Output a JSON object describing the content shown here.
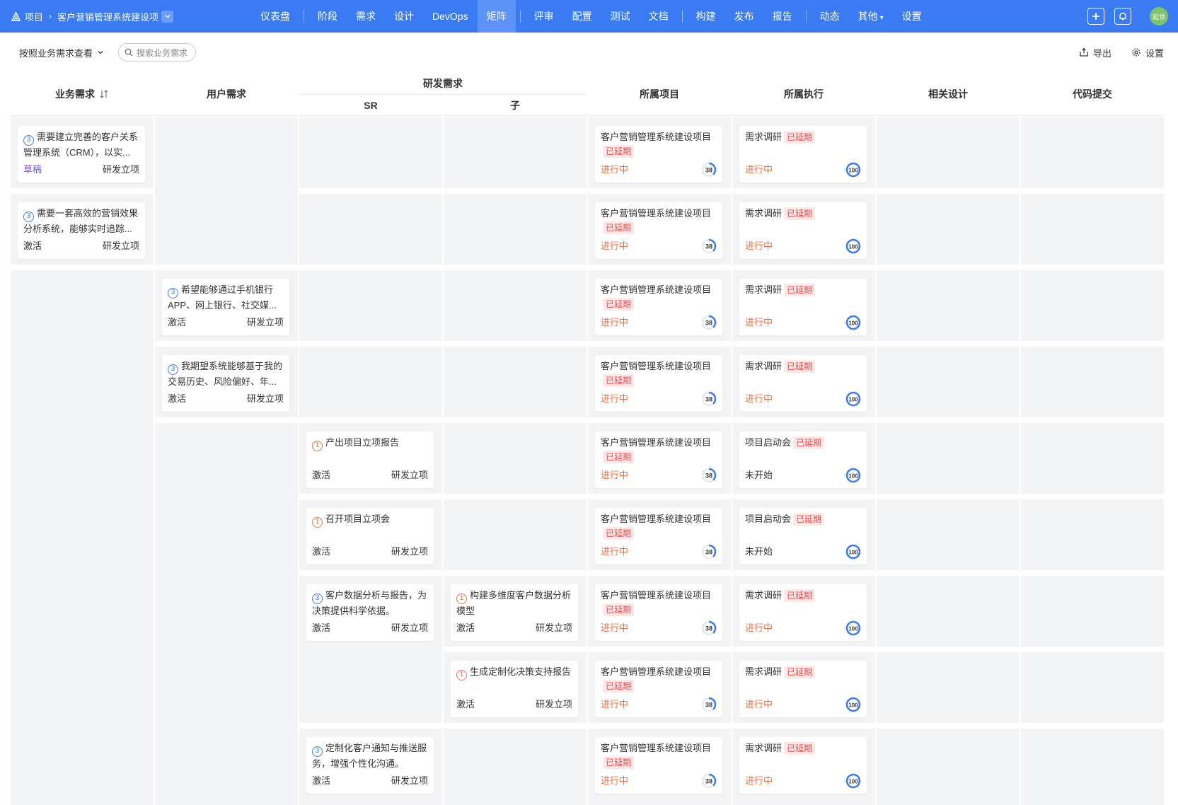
{
  "nav": {
    "root": "项目",
    "project": "客户营销管理系统建设项",
    "tabs": [
      "仪表盘",
      "阶段",
      "需求",
      "设计",
      "DevOps",
      "矩阵",
      "评审",
      "配置",
      "测试",
      "文档",
      "构建",
      "发布",
      "报告",
      "动态",
      "其他",
      "设置"
    ],
    "active_tab": "矩阵",
    "avatar": "延世"
  },
  "toolbar": {
    "view": "按照业务需求查看",
    "search_placeholder": "搜索业务需求",
    "export": "导出",
    "settings": "设置"
  },
  "headers": {
    "business": "业务需求",
    "user": "用户需求",
    "dev_group": "研发需求",
    "sr": "SR",
    "child": "子",
    "project": "所属项目",
    "execution": "所属执行",
    "design": "相关设计",
    "code": "代码提交"
  },
  "business_cards": [
    {
      "num": "3",
      "title": "需要建立完善的客户关系管理系统（CRM），以实...",
      "status": "草稿",
      "stage": "研发立项"
    },
    {
      "num": "3",
      "title": "需要一套高效的营销效果分析系统，能够实时追踪...",
      "status": "激活",
      "stage": "研发立项"
    }
  ],
  "user_cards": [
    {
      "num": "3",
      "title": "希望能够通过手机银行APP、网上银行、社交媒...",
      "status": "激活",
      "stage": "研发立项"
    },
    {
      "num": "3",
      "title": "我期望系统能够基于我的交易历史、风险偏好、年...",
      "status": "激活",
      "stage": "研发立项"
    }
  ],
  "sr_cards": [
    {
      "num": "1",
      "title": "产出项目立项报告",
      "status": "激活",
      "stage": "研发立项"
    },
    {
      "num": "1",
      "title": "召开项目立项会",
      "status": "激活",
      "stage": "研发立项"
    },
    {
      "num": "3",
      "title": "客户数据分析与报告，为决策提供科学依据。",
      "status": "激活",
      "stage": "研发立项"
    },
    {
      "num": "3",
      "title": "定制化客户通知与推送服务，增强个性化沟通。",
      "status": "激活",
      "stage": "研发立项"
    }
  ],
  "child_cards": [
    {
      "num": "1",
      "title": "构建多维度客户数据分析模型",
      "status": "激活",
      "stage": "研发立项"
    },
    {
      "num": "1",
      "title": "生成定制化决策支持报告",
      "status": "激活",
      "stage": "研发立项"
    }
  ],
  "project_card": {
    "name": "客户营销管理系统建设项目",
    "tag": "已延期",
    "status": "进行中",
    "progress": 38
  },
  "execution_cards": [
    {
      "name": "需求调研",
      "tag": "已延期",
      "status": "进行中",
      "progress": 100
    },
    {
      "name": "需求调研",
      "tag": "已延期",
      "status": "进行中",
      "progress": 100
    },
    {
      "name": "需求调研",
      "tag": "已延期",
      "status": "进行中",
      "progress": 100
    },
    {
      "name": "需求调研",
      "tag": "已延期",
      "status": "进行中",
      "progress": 100
    },
    {
      "name": "项目启动会",
      "tag": "已延期",
      "status": "未开始",
      "progress": 100
    },
    {
      "name": "项目启动会",
      "tag": "已延期",
      "status": "未开始",
      "progress": 100
    },
    {
      "name": "需求调研",
      "tag": "已延期",
      "status": "进行中",
      "progress": 100
    },
    {
      "name": "需求调研",
      "tag": "已延期",
      "status": "进行中",
      "progress": 100
    },
    {
      "name": "需求调研",
      "tag": "已延期",
      "status": "进行中",
      "progress": 100
    }
  ],
  "colors": {
    "accent": "#3a7bf4",
    "warn": "#f26b3a",
    "tag": "#f5484a"
  }
}
